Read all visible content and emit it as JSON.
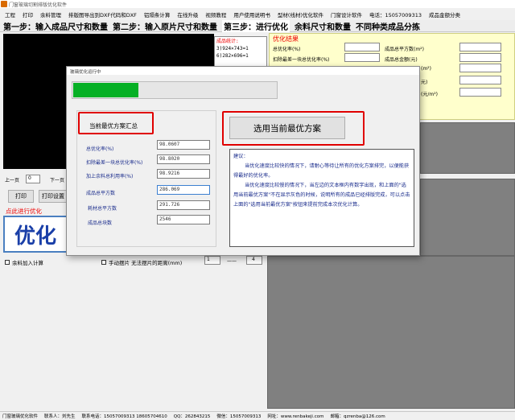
{
  "window": {
    "title": "门窗玻璃切割排版优化软件"
  },
  "menu": [
    "工程",
    "打印",
    "余料管理",
    "排版图导出到DXF代码和DXF",
    "铝隔条计算",
    "在线升级",
    "视频教程",
    "用户使用说明书",
    "型材(线材)优化软件",
    "门窗设计软件",
    "电话：15057009313",
    "成品金额分类"
  ],
  "steps": [
    {
      "label": "第一步：输入成品尺寸和数量"
    },
    {
      "label": "第二步：输入原片尺寸和数量"
    },
    {
      "label": "第三步：进行优化"
    },
    {
      "label": "余料尺寸和数量"
    },
    {
      "label": "不同种类成品分拣"
    }
  ],
  "stats": {
    "header": "成品统计:",
    "lines": [
      "3)924×743=1",
      "6)282×696=1"
    ]
  },
  "result": {
    "header": "优化结果",
    "left_labels": [
      "总优化率(%)",
      "扣除最差一块总优化率(%)"
    ],
    "right_labels": [
      "成品总平方数(m²)",
      "成品总金额(元)",
      "(m²)",
      "元)",
      "(元/m²)"
    ]
  },
  "left_controls": {
    "prev_label": "上一页",
    "page_value": "0",
    "next_label": "下一页",
    "print_label": "打印",
    "print_settings_label": "打印设置",
    "optimize_link": "点此进行优化",
    "optimize_button": "优化",
    "leftover_check": "余料加入计算"
  },
  "manual": {
    "label": "手动摆片 无法摆片的距离(mm)",
    "value1": "1",
    "dash": "——",
    "value2": "4"
  },
  "dialog": {
    "title": "玻璃优化运行中",
    "progress": 0.32,
    "summary_title": "当前最优方案汇总",
    "fields": [
      {
        "label": "总优化率(%)",
        "value": "98.0607"
      },
      {
        "label": "扣除最差一块总优化率(%)",
        "value": "98.8020"
      },
      {
        "label": "加上余料总利用率(%)",
        "value": "98.9216"
      },
      {
        "label": "成品总平方数",
        "value": "286.069"
      },
      {
        "label": "耗材总平方数",
        "value": "291.726"
      },
      {
        "label": "成品总块数",
        "value": "2546"
      }
    ],
    "select_button": "选用当前最优方案",
    "advice": {
      "title": "建议：",
      "para1": "当优化速度比较快的情况下，请耐心等待让所有的优化方案排完，以便能获得最好的优化率。",
      "para2": "当优化速度比较慢的情况下，当左边的文本框内有数字出现，和上面的\"选用当前最优方案\"不在显示灰色的时候，说明所有的成品已经排版完成，可以点击上面的\"选用当前最优方案\"按钮来提前完成本次优化计算。"
    }
  },
  "status": [
    "门窗玻璃优化软件",
    "联系人：刘先生",
    "联系电话：15057009313 18605704610",
    "QQ：262843215",
    "微信：15057009313",
    "网址：www.renbakeji.com",
    "邮箱：qzrenba@126.com"
  ],
  "colors": {
    "progress": "#06b025",
    "highlight": "#e00000",
    "result_bg": "#ffffcc",
    "link_blue": "#1a2c8c"
  }
}
